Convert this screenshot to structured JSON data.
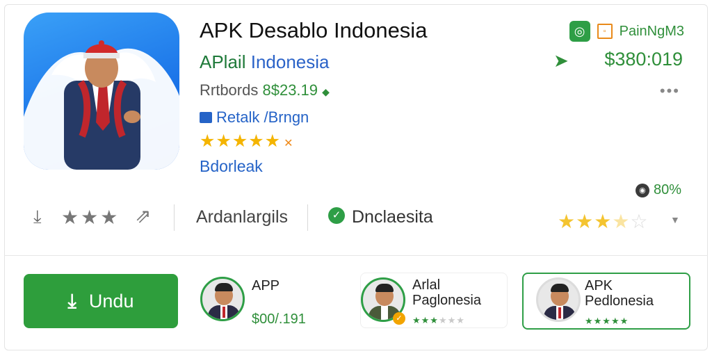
{
  "app": {
    "title": "APK Desablo Indonesia",
    "subtitle_a": "APlail",
    "subtitle_b": "Indonesia",
    "price_label": "Rrtbords",
    "price_value": "8$23.19",
    "category": "Retalk /Brngn",
    "rating_stars": "★★★★★",
    "rating_extra": "✕",
    "developer": "Bdorleak"
  },
  "top_right": {
    "label": "PainNgM3",
    "price": "$380:019",
    "percent": "80%"
  },
  "stats": {
    "stars": "★★★",
    "middle_label": "Ardanlargils",
    "verified_label": "Dnclaesita",
    "rating_on": "★★★",
    "rating_half": "★",
    "rating_off": "☆"
  },
  "download_button": {
    "label": "Undu"
  },
  "related": [
    {
      "line1": "APP",
      "line2": "$00/.191"
    },
    {
      "line1": "Arlal",
      "line1b": "Paglonesia",
      "stars_on": "★★★",
      "stars_off": "★★★"
    },
    {
      "line1": "APK",
      "line1b": "Pedlonesia",
      "stars_on": "★★★★★"
    }
  ],
  "colors": {
    "brand_green": "#2e9e3c",
    "link_blue": "#2563c7",
    "star_gold": "#f4b400",
    "icon_blue": "#1a73e8"
  }
}
